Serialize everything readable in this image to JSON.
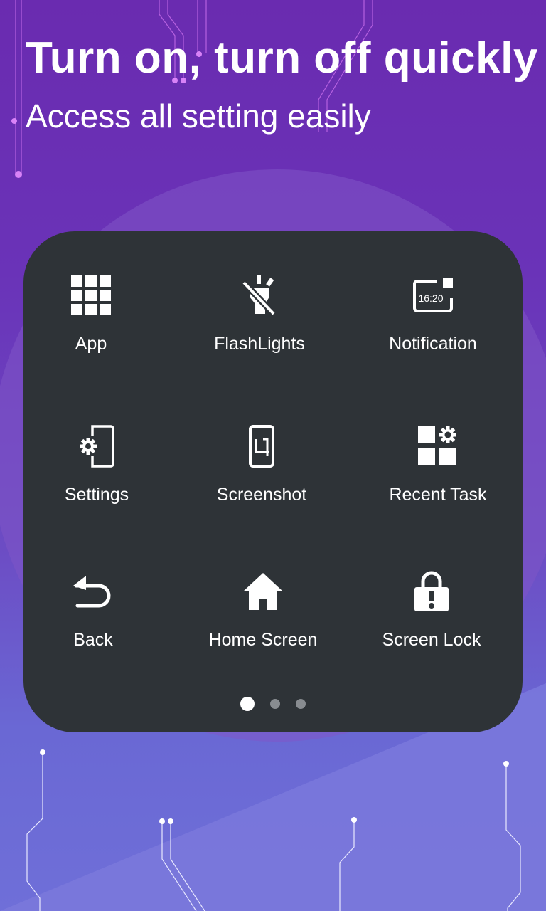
{
  "header": {
    "title": "Turn on, turn off quickly",
    "subtitle": "Access all setting easily"
  },
  "panel": {
    "tiles": [
      {
        "label": "App",
        "icon": "app-grid-icon"
      },
      {
        "label": "FlashLights",
        "icon": "flashlight-off-icon"
      },
      {
        "label": "Notification",
        "icon": "notification-icon",
        "icon_text": "16:20"
      },
      {
        "label": "Settings",
        "icon": "settings-icon"
      },
      {
        "label": "Screenshot",
        "icon": "screenshot-crop-icon"
      },
      {
        "label": "Recent Task",
        "icon": "recent-task-icon"
      },
      {
        "label": "Back",
        "icon": "back-arrow-icon"
      },
      {
        "label": "Home Screen",
        "icon": "home-icon"
      },
      {
        "label": "Screen Lock",
        "icon": "lock-icon"
      }
    ],
    "pagination": {
      "pages": 3,
      "current": 1
    }
  },
  "colors": {
    "panel_bg": "#2e3337",
    "bg_top": "#6a2bb0",
    "bg_bottom": "#6f6fd8",
    "text": "#ffffff",
    "dot_active": "#ffffff",
    "dot_inactive": "#888c90"
  }
}
